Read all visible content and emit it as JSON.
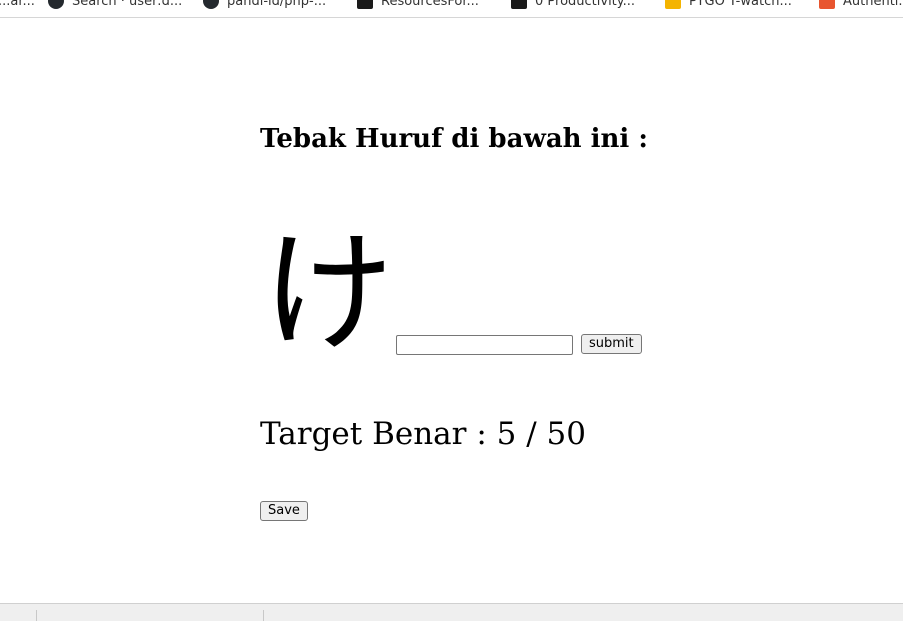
{
  "bookmarks": [
    {
      "label": "...ar...",
      "icon": "bookmark-icon"
    },
    {
      "label": "Search · user:d...",
      "icon": "github-icon"
    },
    {
      "label": "pandi-id/php-...",
      "icon": "github-icon"
    },
    {
      "label": "ResourcesFor...",
      "icon": "dev-icon"
    },
    {
      "label": "0 Productivity...",
      "icon": "dev-icon"
    },
    {
      "label": "PYGO T-watch...",
      "icon": "yellow-icon"
    },
    {
      "label": "Authenti...",
      "icon": "orange-icon"
    }
  ],
  "page": {
    "title": "Tebak Huruf di bawah ini :",
    "character": "け",
    "answer_value": "",
    "submit_label": "submit",
    "target_text": "Target Benar : 5 / 50",
    "save_label": "Save"
  }
}
